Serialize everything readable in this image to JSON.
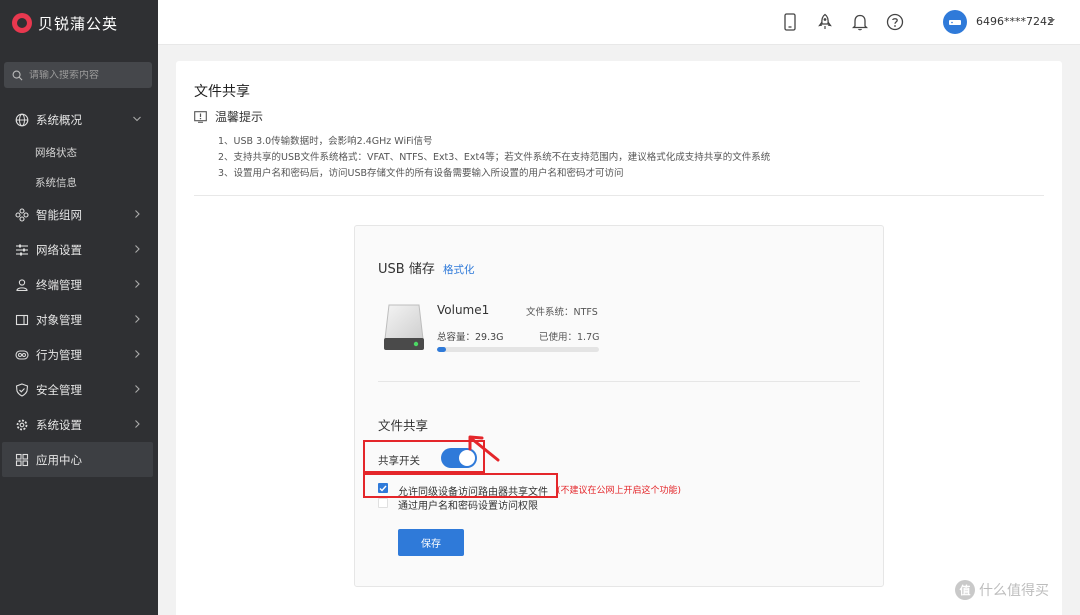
{
  "brand": {
    "name": "贝锐蒲公英"
  },
  "search": {
    "placeholder": "请输入搜索内容"
  },
  "sidebar": {
    "items": [
      {
        "label": "系统概况",
        "icon": "globe-icon",
        "expanded": true
      },
      {
        "label": "网络状态",
        "sub": true
      },
      {
        "label": "系统信息",
        "sub": true
      },
      {
        "label": "智能组网",
        "icon": "network-icon"
      },
      {
        "label": "网络设置",
        "icon": "sliders-icon"
      },
      {
        "label": "终端管理",
        "icon": "users-icon"
      },
      {
        "label": "对象管理",
        "icon": "object-icon"
      },
      {
        "label": "行为管理",
        "icon": "eye-icon"
      },
      {
        "label": "安全管理",
        "icon": "shield-icon"
      },
      {
        "label": "系统设置",
        "icon": "gear-icon"
      },
      {
        "label": "应用中心",
        "icon": "grid-icon",
        "active": true
      }
    ]
  },
  "header": {
    "account": "6496****7242"
  },
  "page": {
    "title": "文件共享",
    "tip_title": "温馨提示",
    "tips": [
      "1、USB 3.0传输数据时，会影响2.4GHz WiFi信号",
      "2、支持共享的USB文件系统格式：VFAT、NTFS、Ext3、Ext4等；若文件系统不在支持范围内，建议格式化成支持共享的文件系统",
      "3、设置用户名和密码后，访问USB存储文件的所有设备需要输入所设置的用户名和密码才可访问"
    ]
  },
  "usb": {
    "title": "USB 储存",
    "format_link": "格式化",
    "volume": "Volume1",
    "filesystem": "文件系统：NTFS",
    "total": "总容量：29.3G",
    "used": "已使用：1.7G",
    "used_fraction": 0.058
  },
  "share": {
    "title": "文件共享",
    "toggle_label": "共享开关",
    "toggle_on": true,
    "option1": "允许同级设备访问路由器共享文件",
    "option1_warning": "(不建议在公网上开启这个功能)",
    "option1_checked": true,
    "option2": "通过用户名和密码设置访问权限",
    "option2_checked": false,
    "save_label": "保存"
  },
  "watermark": {
    "badge": "值",
    "text": "什么值得买"
  },
  "colors": {
    "accent": "#2f7ad9",
    "sidebar": "#2f3033",
    "highlight": "#e4262a"
  }
}
